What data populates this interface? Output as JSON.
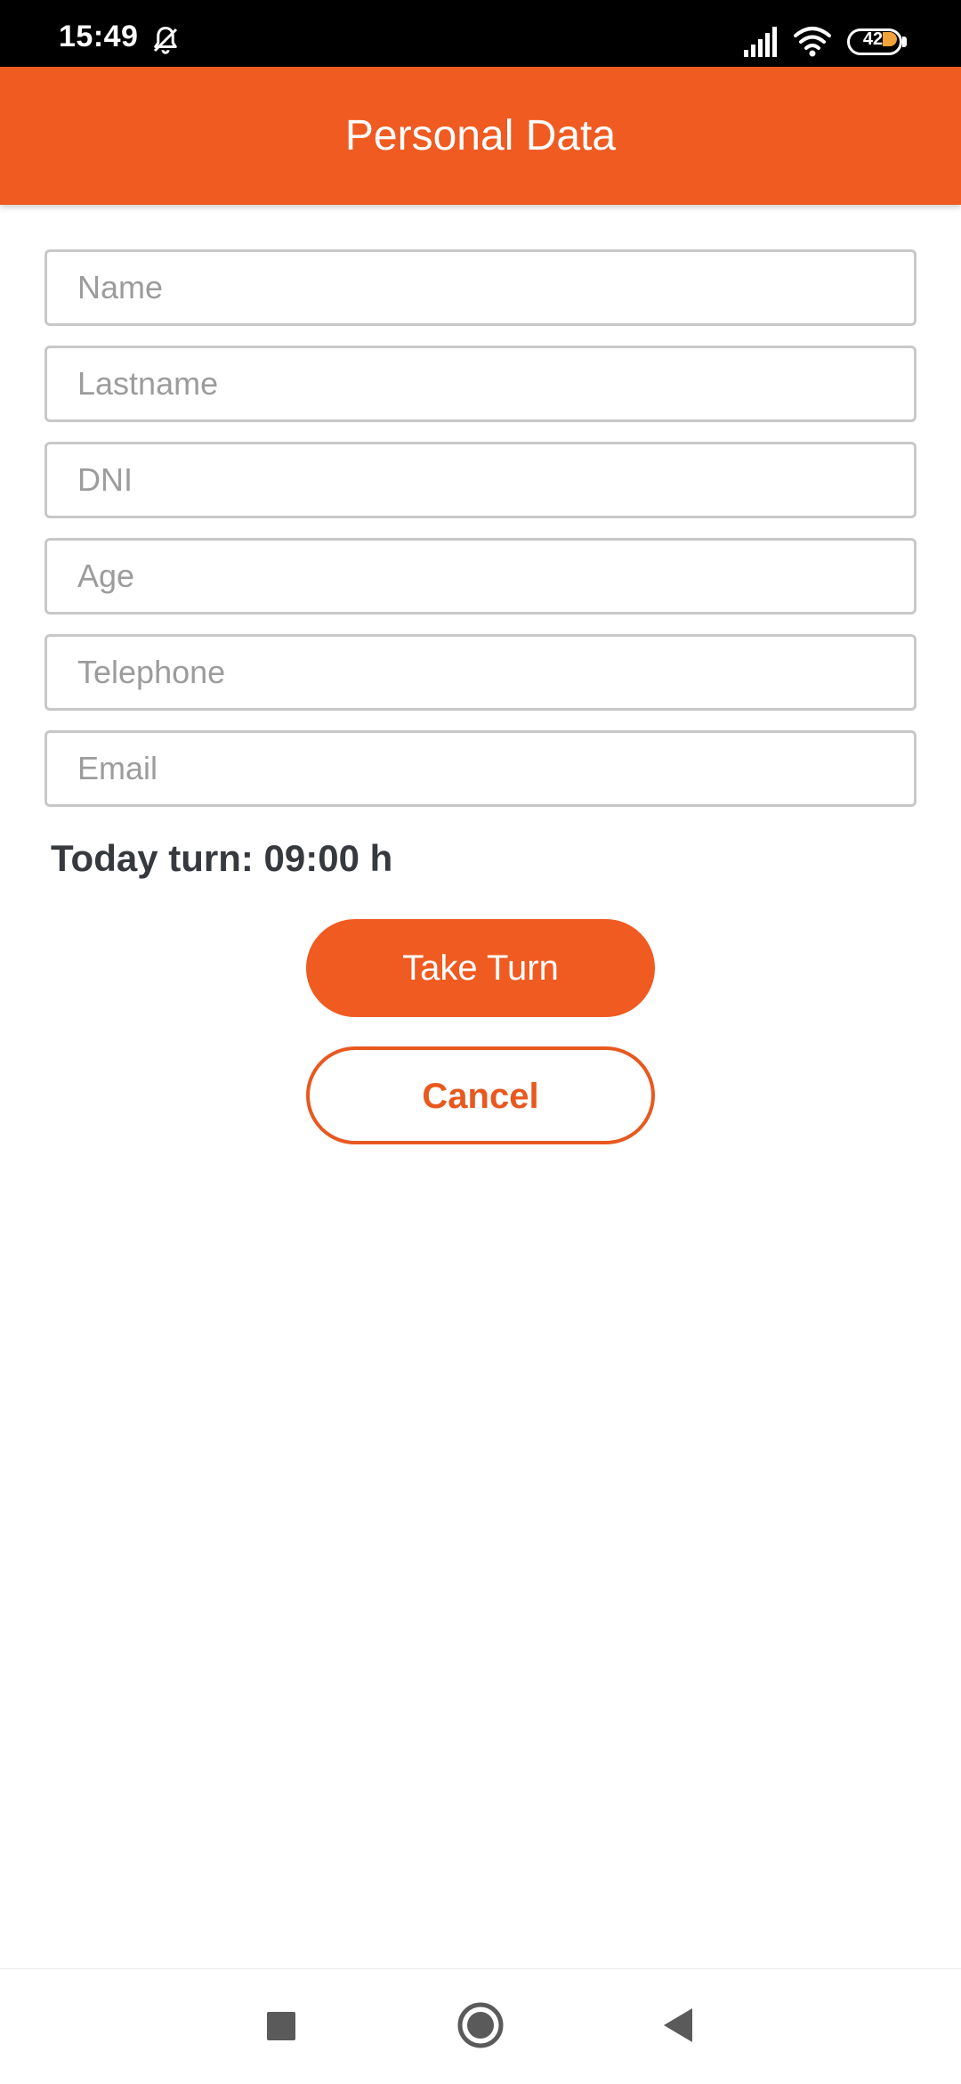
{
  "status_bar": {
    "time": "15:49",
    "battery_level": "42",
    "icons": [
      "bell-off-icon",
      "signal-icon",
      "wifi-icon",
      "battery-icon"
    ]
  },
  "app_bar": {
    "title": "Personal Data"
  },
  "form": {
    "fields": [
      {
        "placeholder": "Name",
        "value": ""
      },
      {
        "placeholder": "Lastname",
        "value": ""
      },
      {
        "placeholder": "DNI",
        "value": ""
      },
      {
        "placeholder": "Age",
        "value": ""
      },
      {
        "placeholder": "Telephone",
        "value": ""
      },
      {
        "placeholder": "Email",
        "value": ""
      }
    ],
    "turn_text": "Today turn: 09:00 h"
  },
  "buttons": {
    "take_turn": "Take Turn",
    "cancel": "Cancel"
  },
  "nav_bar": {
    "icons": [
      "recent-apps-icon",
      "home-icon",
      "back-icon"
    ]
  },
  "colors": {
    "accent": "#f05b22",
    "status_bar": "#000000",
    "text_dark": "#36393d",
    "placeholder": "#9c9c9c",
    "field_border": "#c8c8c8"
  }
}
